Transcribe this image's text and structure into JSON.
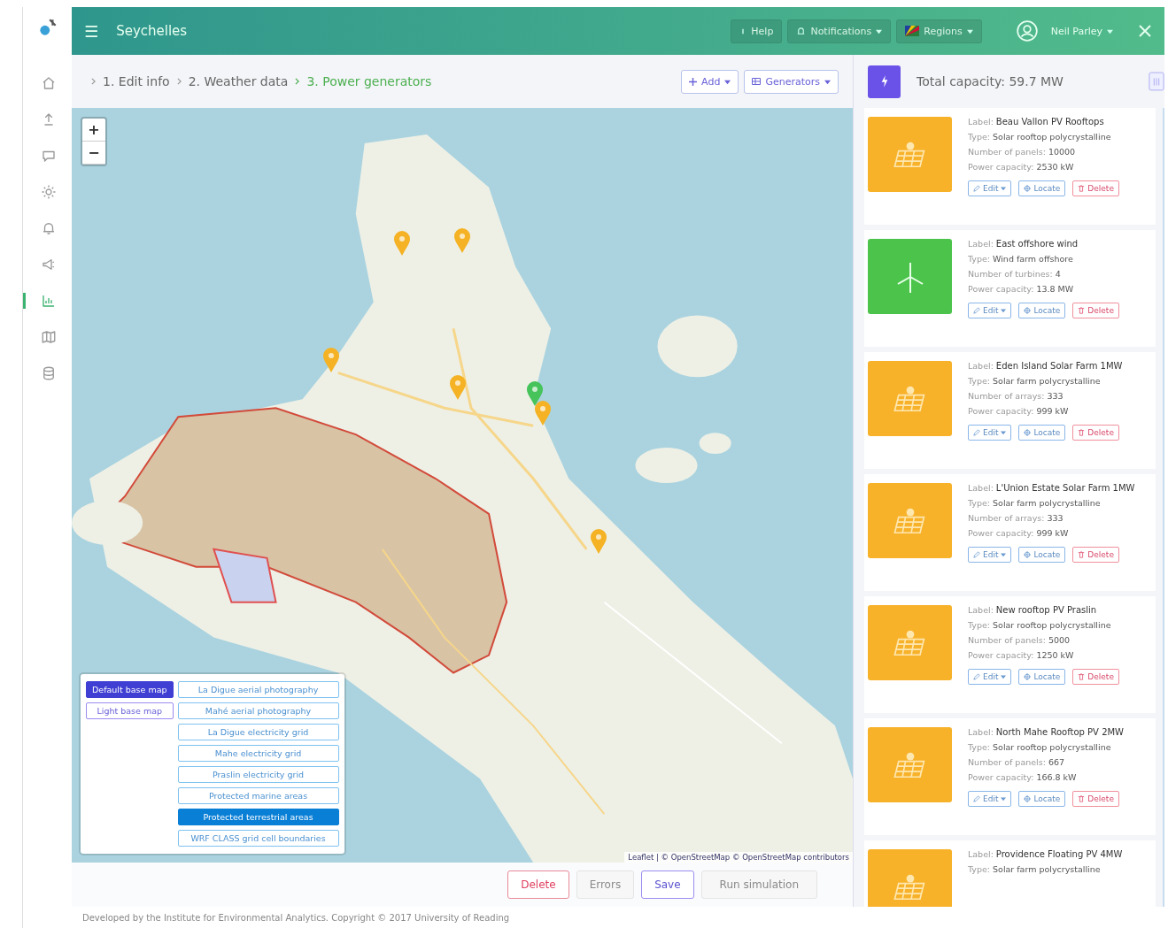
{
  "header": {
    "menu_icon": "☰",
    "title": "Seychelles",
    "buttons": [
      {
        "label": "Help",
        "kind": "help"
      },
      {
        "label": "Notifications",
        "kind": "bell"
      },
      {
        "label": "Regions",
        "kind": "flag"
      }
    ],
    "user": "Neil Parley"
  },
  "sidebar": {
    "items": [
      {
        "kind": "home",
        "selected": false
      },
      {
        "kind": "upload",
        "selected": false
      },
      {
        "kind": "chat",
        "selected": false
      },
      {
        "kind": "gear",
        "selected": false
      },
      {
        "kind": "bell",
        "selected": false
      },
      {
        "kind": "megaphone",
        "selected": false
      },
      {
        "kind": "chart",
        "selected": true
      },
      {
        "kind": "map",
        "selected": false
      },
      {
        "kind": "database",
        "selected": false
      }
    ]
  },
  "breadcrumb": [
    {
      "label": "1. Edit info",
      "selected": false
    },
    {
      "label": "2. Weather data",
      "selected": false
    },
    {
      "label": "3. Power generators",
      "selected": true
    }
  ],
  "toolbar": {
    "add": "Add",
    "generators": "Generators"
  },
  "summary": {
    "total": "Total capacity: 59.7 MW"
  },
  "map": {
    "zoom_in": "+",
    "zoom_out": "−",
    "attribution": "Leaflet | © OpenStreetMap © OpenStreetMap contributors",
    "markers": [
      {
        "kind": "solar"
      },
      {
        "kind": "solar"
      },
      {
        "kind": "solar"
      },
      {
        "kind": "solar"
      },
      {
        "kind": "wind"
      },
      {
        "kind": "solar"
      },
      {
        "kind": "solar"
      }
    ],
    "base_layers": [
      {
        "label": "Default base map",
        "selected": true
      },
      {
        "label": "Light base map",
        "selected": false
      }
    ],
    "overlays": [
      {
        "label": "La Digue aerial photography",
        "selected": false
      },
      {
        "label": "Mahé aerial photography",
        "selected": false
      },
      {
        "label": "La Digue electricity grid",
        "selected": false
      },
      {
        "label": "Mahe electricity grid",
        "selected": false
      },
      {
        "label": "Praslin electricity grid",
        "selected": false
      },
      {
        "label": "Protected marine areas",
        "selected": false
      },
      {
        "label": "Protected terrestrial areas",
        "selected": true
      },
      {
        "label": "WRF CLASS grid cell boundaries",
        "selected": false
      }
    ]
  },
  "actions": [
    {
      "label": "Delete",
      "kind": "danger",
      "disabled": false
    },
    {
      "label": "Errors",
      "kind": "warning",
      "disabled": true
    },
    {
      "label": "Save",
      "kind": "primary",
      "disabled": false
    },
    {
      "label": "Run simulation",
      "kind": "success",
      "disabled": true
    }
  ],
  "generators": [
    {
      "kind": "solar",
      "label_caption": "Label:",
      "label": "Beau Vallon PV Rooftops",
      "type_caption": "Type:",
      "type": "Solar rooftop polycrystalline",
      "count_label": "Number of panels:",
      "count": "10000",
      "capacity_caption": "Power capacity:",
      "capacity": "2530 kW",
      "buttons": [
        "Edit",
        "Locate",
        "Delete"
      ]
    },
    {
      "kind": "wind",
      "label_caption": "Label:",
      "label": "East offshore wind",
      "type_caption": "Type:",
      "type": "Wind farm offshore",
      "count_label": "Number of turbines:",
      "count": "4",
      "capacity_caption": "Power capacity:",
      "capacity": "13.8 MW",
      "buttons": [
        "Edit",
        "Locate",
        "Delete"
      ]
    },
    {
      "kind": "solar",
      "label_caption": "Label:",
      "label": "Eden Island Solar Farm 1MW",
      "type_caption": "Type:",
      "type": "Solar farm polycrystalline",
      "count_label": "Number of arrays:",
      "count": "333",
      "capacity_caption": "Power capacity:",
      "capacity": "999 kW",
      "buttons": [
        "Edit",
        "Locate",
        "Delete"
      ]
    },
    {
      "kind": "solar",
      "label_caption": "Label:",
      "label": "L'Union Estate Solar Farm 1MW",
      "type_caption": "Type:",
      "type": "Solar farm polycrystalline",
      "count_label": "Number of arrays:",
      "count": "333",
      "capacity_caption": "Power capacity:",
      "capacity": "999 kW",
      "buttons": [
        "Edit",
        "Locate",
        "Delete"
      ]
    },
    {
      "kind": "solar",
      "label_caption": "Label:",
      "label": "New rooftop PV Praslin",
      "type_caption": "Type:",
      "type": "Solar rooftop polycrystalline",
      "count_label": "Number of panels:",
      "count": "5000",
      "capacity_caption": "Power capacity:",
      "capacity": "1250 kW",
      "buttons": [
        "Edit",
        "Locate",
        "Delete"
      ]
    },
    {
      "kind": "solar",
      "label_caption": "Label:",
      "label": "North Mahe Rooftop PV 2MW",
      "type_caption": "Type:",
      "type": "Solar rooftop polycrystalline",
      "count_label": "Number of panels:",
      "count": "667",
      "capacity_caption": "Power capacity:",
      "capacity": "166.8 kW",
      "buttons": [
        "Edit",
        "Locate",
        "Delete"
      ]
    },
    {
      "kind": "solar",
      "label_caption": "Label:",
      "label": "Providence Floating PV 4MW",
      "type_caption": "Type:",
      "type": "Solar farm polycrystalline"
    }
  ],
  "footer": "Developed by the Institute for Environmental Analytics. Copyright © 2017 University of Reading"
}
